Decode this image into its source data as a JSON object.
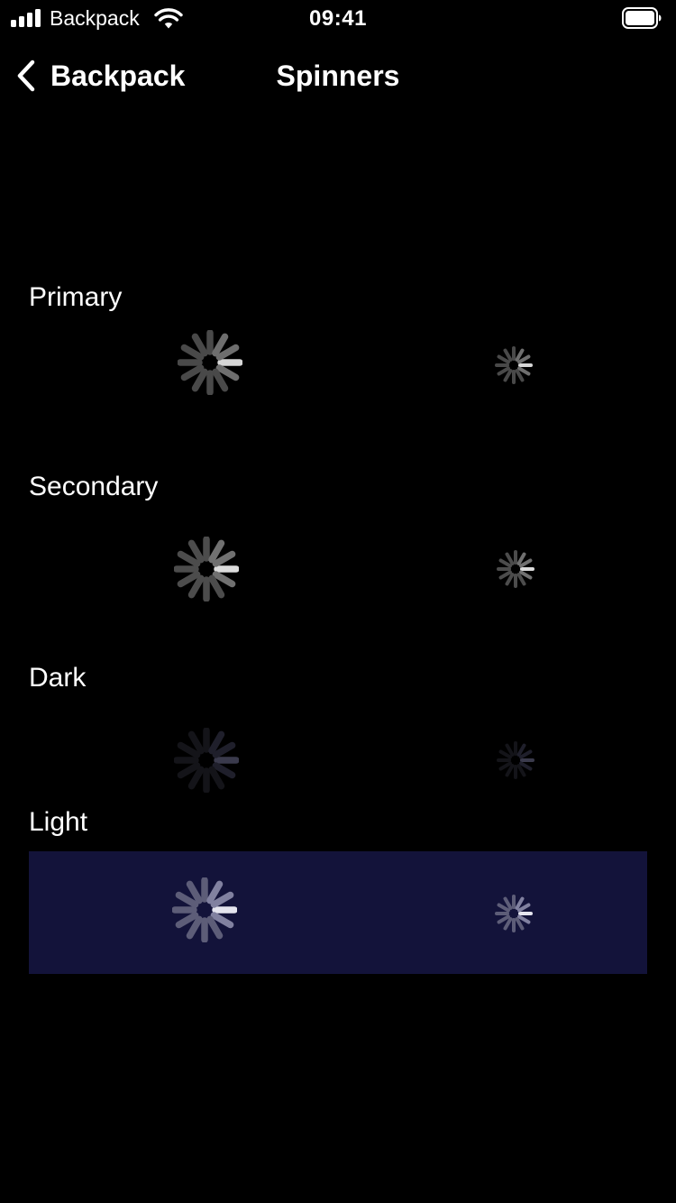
{
  "status_bar": {
    "carrier": "Backpack",
    "time": "09:41"
  },
  "nav": {
    "back_label": "Backpack",
    "title": "Spinners"
  },
  "sections": [
    {
      "title": "Primary",
      "colors": {
        "base": "#494949",
        "light": "#6e6e6e",
        "lightest": "#d6d6d6"
      }
    },
    {
      "title": "Secondary",
      "colors": {
        "base": "#4c4c4c",
        "light": "#707070",
        "lightest": "#dcdcdc"
      }
    },
    {
      "title": "Dark",
      "colors": {
        "base": "#141419",
        "light": "#1f1f2b",
        "lightest": "#3a3a4c"
      }
    },
    {
      "title": "Light",
      "colors": {
        "base": "#5d5d78",
        "light": "#8181a0",
        "lightest": "#e4e4ee"
      },
      "background": "#13133a"
    }
  ],
  "spinner_sizes": [
    "large",
    "small"
  ]
}
